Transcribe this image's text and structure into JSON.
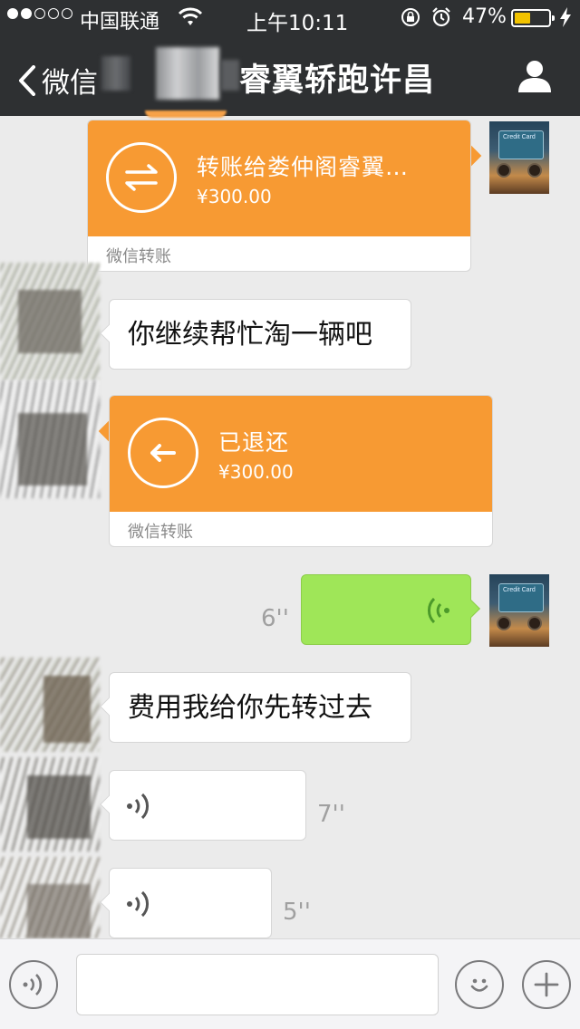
{
  "status_bar": {
    "carrier": "中国联通",
    "time": "上午10:11",
    "battery_percent": "47%",
    "battery_level": 0.47,
    "signal_bars": 2
  },
  "nav": {
    "back_label": "微信",
    "title": "睿翼轿跑许昌"
  },
  "messages": [
    {
      "type": "transfer",
      "side": "right",
      "title": "转账给娄仲阁睿翼…",
      "amount": "¥300.00",
      "footer": "微信转账"
    },
    {
      "type": "text",
      "side": "left",
      "text": "你继续帮忙淘一辆吧"
    },
    {
      "type": "transfer",
      "side": "left",
      "title": "已退还",
      "amount": "¥300.00",
      "footer": "微信转账"
    },
    {
      "type": "voice",
      "side": "right",
      "duration": "6''"
    },
    {
      "type": "text",
      "side": "left",
      "text": "费用我给你先转过去"
    },
    {
      "type": "voice",
      "side": "left",
      "duration": "7''"
    },
    {
      "type": "voice",
      "side": "left",
      "duration": "5''"
    }
  ],
  "avatar_card_text": "Credit Card",
  "input_bar": {
    "text_value": ""
  },
  "colors": {
    "header_bg": "#2e3032",
    "chat_bg": "#ebebeb",
    "transfer_orange": "#f79a33",
    "voice_green": "#9fe658",
    "battery_yellow": "#f2c300"
  },
  "icons": [
    "wifi-icon",
    "lock-rotation-icon",
    "alarm-icon",
    "charging-icon",
    "back-chevron-icon",
    "person-icon",
    "transfer-arrows-icon",
    "return-arrow-icon",
    "voice-wave-icon",
    "voice-input-icon",
    "emoji-icon",
    "plus-icon"
  ]
}
